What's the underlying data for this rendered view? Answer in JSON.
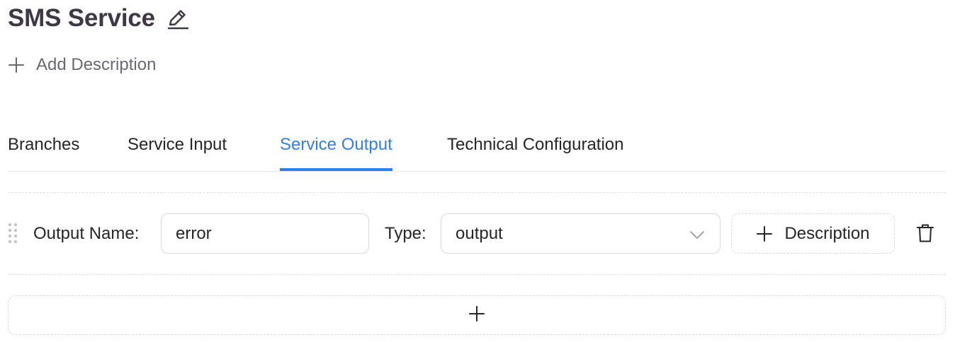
{
  "header": {
    "title": "SMS Service",
    "edit_icon": "pencil-icon"
  },
  "description": {
    "add_label": "Add Description",
    "icon": "plus-icon"
  },
  "tabs": [
    {
      "label": "Branches",
      "active": false
    },
    {
      "label": "Service Input",
      "active": false
    },
    {
      "label": "Service Output",
      "active": true
    },
    {
      "label": "Technical Configuration",
      "active": false
    }
  ],
  "output_row": {
    "drag_icon": "drag-handle-icon",
    "name_label": "Output Name:",
    "name_value": "error",
    "type_label": "Type:",
    "type_value": "output",
    "type_icon": "chevron-down-icon",
    "description_button": "Description",
    "delete_icon": "trash-icon"
  },
  "add_row": {
    "icon": "plus-icon"
  },
  "colors": {
    "accent": "#2f80ed",
    "title": "#3f3844",
    "muted": "#6d6771",
    "border": "#d9d9d9"
  }
}
